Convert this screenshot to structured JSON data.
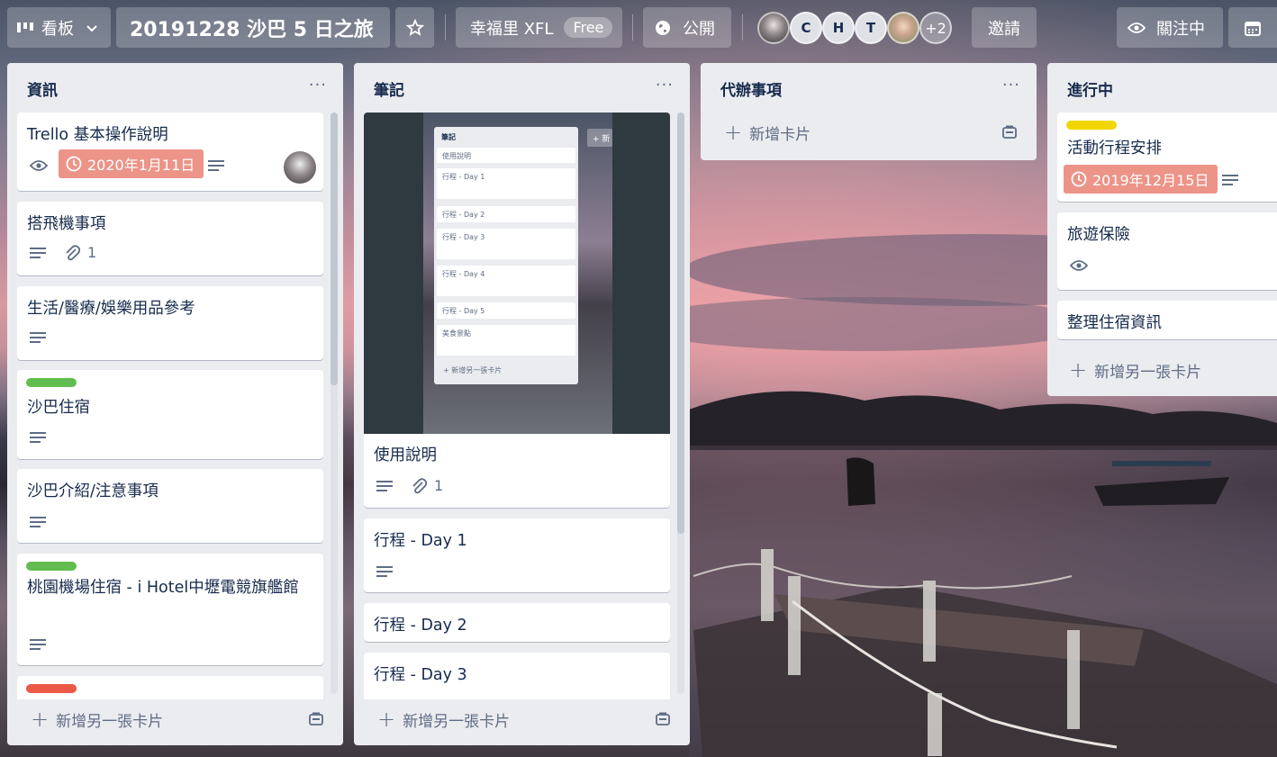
{
  "header": {
    "board_view_label": "看板",
    "board_title": "20191228 沙巴 5 日之旅",
    "team_name": "幸福里 XFL",
    "team_plan": "Free",
    "visibility_label": "公開",
    "member_initials": [
      "C",
      "H",
      "T"
    ],
    "more_members": "+2",
    "invite_label": "邀請",
    "watching_label": "關注中"
  },
  "lists": [
    {
      "title": "資訊",
      "menu": "···",
      "add_card": "新增另一張卡片",
      "cards": [
        {
          "title": "Trello 基本操作說明",
          "due": "2020年1月11日"
        },
        {
          "title": "搭飛機事項",
          "attachments": "1"
        },
        {
          "title": "生活/醫療/娛樂用品參考"
        },
        {
          "title": "沙巴住宿",
          "label_color": "#61bd4f"
        },
        {
          "title": "沙巴介紹/注意事項"
        },
        {
          "title": "桃園機場住宿 - i Hotel中壢電競旗艦館",
          "label_color": "#61bd4f"
        },
        {
          "title": "",
          "label_color": "#eb5a46"
        }
      ]
    },
    {
      "title": "筆記",
      "menu": "···",
      "add_card": "新增另一張卡片",
      "cover": {
        "list_title": "筆記",
        "add_button": "+ 新",
        "items": [
          "使用說明",
          "行程 - Day 1",
          "行程 - Day 2",
          "行程 - Day 3",
          "行程 - Day 4",
          "行程 - Day 5",
          "美食景點"
        ],
        "add_card": "+ 新增另一張卡片"
      },
      "cards": [
        {
          "title": "使用說明",
          "attachments": "1"
        },
        {
          "title": "行程 - Day 1"
        },
        {
          "title": "行程 - Day 2"
        },
        {
          "title": "行程 - Day 3"
        }
      ]
    },
    {
      "title": "代辦事項",
      "menu": "···",
      "add_card": "新增卡片",
      "cards": []
    },
    {
      "title": "進行中",
      "add_card": "新增另一張卡片",
      "cards": [
        {
          "title": "活動行程安排",
          "label_color": "#f2d600",
          "due": "2019年12月15日"
        },
        {
          "title": "旅遊保險"
        },
        {
          "title": "整理住宿資訊"
        }
      ]
    }
  ],
  "colors": {
    "due_bg": "#ec9488",
    "list_bg": "#ebecf0",
    "label_green": "#61bd4f",
    "label_red": "#eb5a46",
    "label_yellow": "#f2d600"
  }
}
